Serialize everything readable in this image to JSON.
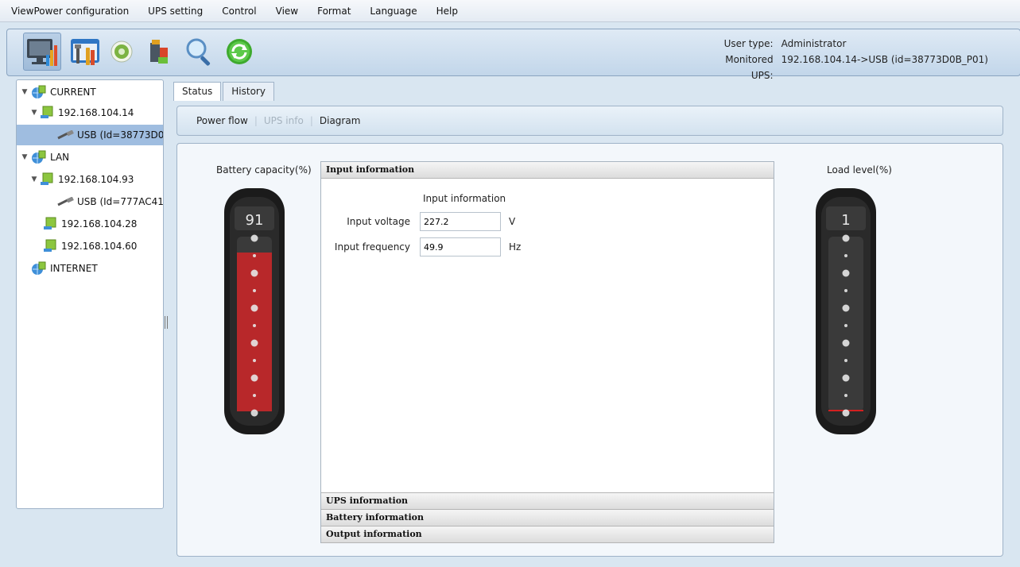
{
  "menu": [
    "ViewPower configuration",
    "UPS setting",
    "Control",
    "View",
    "Format",
    "Language",
    "Help"
  ],
  "toolbar": {
    "icons": [
      "monitor-icon",
      "configuration-tools-icon",
      "ups-setting-icon",
      "control-icon",
      "search-icon",
      "refresh-icon"
    ],
    "user_type_label": "User type:",
    "user_type_value": "Administrator",
    "monitored_label": "Monitored UPS:",
    "monitored_value": "192.168.104.14->USB (id=38773D0B_P01)"
  },
  "tree": {
    "current": "CURRENT",
    "current_host": "192.168.104.14",
    "current_usb": "USB (Id=38773D0",
    "lan": "LAN",
    "lan_host1": "192.168.104.93",
    "lan_usb": "USB (Id=777AC41",
    "lan_host2": "192.168.104.28",
    "lan_host3": "192.168.104.60",
    "internet": "INTERNET"
  },
  "tabs": {
    "status": "Status",
    "history": "History"
  },
  "subnav": {
    "power_flow": "Power flow",
    "ups_info": "UPS info",
    "diagram": "Diagram"
  },
  "battery": {
    "title": "Battery capacity(%)",
    "value": "91",
    "level": 0.91,
    "color": "#b8282a"
  },
  "load": {
    "title": "Load level(%)",
    "value": "1",
    "level": 0.01,
    "color": "#d22020"
  },
  "accordion": {
    "input_header": "Input information",
    "input_caption": "Input information",
    "voltage_label": "Input voltage",
    "voltage_value": "227.2",
    "voltage_unit": "V",
    "frequency_label": "Input frequency",
    "frequency_value": "49.9",
    "frequency_unit": "Hz",
    "ups_header": "UPS information",
    "battery_header": "Battery information",
    "output_header": "Output information"
  }
}
